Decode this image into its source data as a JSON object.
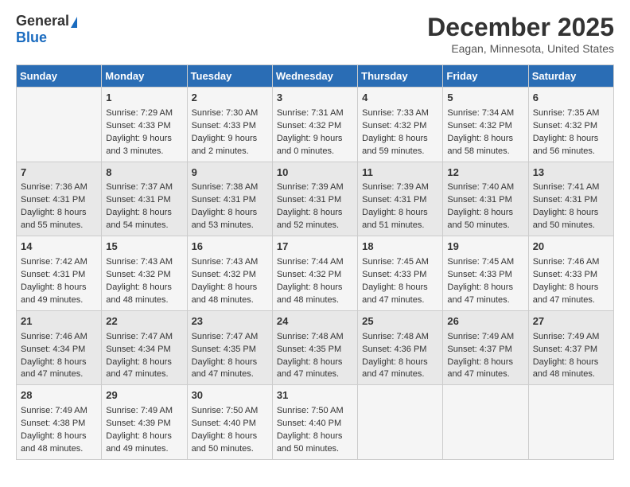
{
  "header": {
    "logo_general": "General",
    "logo_blue": "Blue",
    "month_title": "December 2025",
    "location": "Eagan, Minnesota, United States"
  },
  "days_of_week": [
    "Sunday",
    "Monday",
    "Tuesday",
    "Wednesday",
    "Thursday",
    "Friday",
    "Saturday"
  ],
  "weeks": [
    [
      {
        "day": "",
        "sunrise": "",
        "sunset": "",
        "daylight": ""
      },
      {
        "day": "1",
        "sunrise": "Sunrise: 7:29 AM",
        "sunset": "Sunset: 4:33 PM",
        "daylight": "Daylight: 9 hours and 3 minutes."
      },
      {
        "day": "2",
        "sunrise": "Sunrise: 7:30 AM",
        "sunset": "Sunset: 4:33 PM",
        "daylight": "Daylight: 9 hours and 2 minutes."
      },
      {
        "day": "3",
        "sunrise": "Sunrise: 7:31 AM",
        "sunset": "Sunset: 4:32 PM",
        "daylight": "Daylight: 9 hours and 0 minutes."
      },
      {
        "day": "4",
        "sunrise": "Sunrise: 7:33 AM",
        "sunset": "Sunset: 4:32 PM",
        "daylight": "Daylight: 8 hours and 59 minutes."
      },
      {
        "day": "5",
        "sunrise": "Sunrise: 7:34 AM",
        "sunset": "Sunset: 4:32 PM",
        "daylight": "Daylight: 8 hours and 58 minutes."
      },
      {
        "day": "6",
        "sunrise": "Sunrise: 7:35 AM",
        "sunset": "Sunset: 4:32 PM",
        "daylight": "Daylight: 8 hours and 56 minutes."
      }
    ],
    [
      {
        "day": "7",
        "sunrise": "Sunrise: 7:36 AM",
        "sunset": "Sunset: 4:31 PM",
        "daylight": "Daylight: 8 hours and 55 minutes."
      },
      {
        "day": "8",
        "sunrise": "Sunrise: 7:37 AM",
        "sunset": "Sunset: 4:31 PM",
        "daylight": "Daylight: 8 hours and 54 minutes."
      },
      {
        "day": "9",
        "sunrise": "Sunrise: 7:38 AM",
        "sunset": "Sunset: 4:31 PM",
        "daylight": "Daylight: 8 hours and 53 minutes."
      },
      {
        "day": "10",
        "sunrise": "Sunrise: 7:39 AM",
        "sunset": "Sunset: 4:31 PM",
        "daylight": "Daylight: 8 hours and 52 minutes."
      },
      {
        "day": "11",
        "sunrise": "Sunrise: 7:39 AM",
        "sunset": "Sunset: 4:31 PM",
        "daylight": "Daylight: 8 hours and 51 minutes."
      },
      {
        "day": "12",
        "sunrise": "Sunrise: 7:40 AM",
        "sunset": "Sunset: 4:31 PM",
        "daylight": "Daylight: 8 hours and 50 minutes."
      },
      {
        "day": "13",
        "sunrise": "Sunrise: 7:41 AM",
        "sunset": "Sunset: 4:31 PM",
        "daylight": "Daylight: 8 hours and 50 minutes."
      }
    ],
    [
      {
        "day": "14",
        "sunrise": "Sunrise: 7:42 AM",
        "sunset": "Sunset: 4:31 PM",
        "daylight": "Daylight: 8 hours and 49 minutes."
      },
      {
        "day": "15",
        "sunrise": "Sunrise: 7:43 AM",
        "sunset": "Sunset: 4:32 PM",
        "daylight": "Daylight: 8 hours and 48 minutes."
      },
      {
        "day": "16",
        "sunrise": "Sunrise: 7:43 AM",
        "sunset": "Sunset: 4:32 PM",
        "daylight": "Daylight: 8 hours and 48 minutes."
      },
      {
        "day": "17",
        "sunrise": "Sunrise: 7:44 AM",
        "sunset": "Sunset: 4:32 PM",
        "daylight": "Daylight: 8 hours and 48 minutes."
      },
      {
        "day": "18",
        "sunrise": "Sunrise: 7:45 AM",
        "sunset": "Sunset: 4:33 PM",
        "daylight": "Daylight: 8 hours and 47 minutes."
      },
      {
        "day": "19",
        "sunrise": "Sunrise: 7:45 AM",
        "sunset": "Sunset: 4:33 PM",
        "daylight": "Daylight: 8 hours and 47 minutes."
      },
      {
        "day": "20",
        "sunrise": "Sunrise: 7:46 AM",
        "sunset": "Sunset: 4:33 PM",
        "daylight": "Daylight: 8 hours and 47 minutes."
      }
    ],
    [
      {
        "day": "21",
        "sunrise": "Sunrise: 7:46 AM",
        "sunset": "Sunset: 4:34 PM",
        "daylight": "Daylight: 8 hours and 47 minutes."
      },
      {
        "day": "22",
        "sunrise": "Sunrise: 7:47 AM",
        "sunset": "Sunset: 4:34 PM",
        "daylight": "Daylight: 8 hours and 47 minutes."
      },
      {
        "day": "23",
        "sunrise": "Sunrise: 7:47 AM",
        "sunset": "Sunset: 4:35 PM",
        "daylight": "Daylight: 8 hours and 47 minutes."
      },
      {
        "day": "24",
        "sunrise": "Sunrise: 7:48 AM",
        "sunset": "Sunset: 4:35 PM",
        "daylight": "Daylight: 8 hours and 47 minutes."
      },
      {
        "day": "25",
        "sunrise": "Sunrise: 7:48 AM",
        "sunset": "Sunset: 4:36 PM",
        "daylight": "Daylight: 8 hours and 47 minutes."
      },
      {
        "day": "26",
        "sunrise": "Sunrise: 7:49 AM",
        "sunset": "Sunset: 4:37 PM",
        "daylight": "Daylight: 8 hours and 47 minutes."
      },
      {
        "day": "27",
        "sunrise": "Sunrise: 7:49 AM",
        "sunset": "Sunset: 4:37 PM",
        "daylight": "Daylight: 8 hours and 48 minutes."
      }
    ],
    [
      {
        "day": "28",
        "sunrise": "Sunrise: 7:49 AM",
        "sunset": "Sunset: 4:38 PM",
        "daylight": "Daylight: 8 hours and 48 minutes."
      },
      {
        "day": "29",
        "sunrise": "Sunrise: 7:49 AM",
        "sunset": "Sunset: 4:39 PM",
        "daylight": "Daylight: 8 hours and 49 minutes."
      },
      {
        "day": "30",
        "sunrise": "Sunrise: 7:50 AM",
        "sunset": "Sunset: 4:40 PM",
        "daylight": "Daylight: 8 hours and 50 minutes."
      },
      {
        "day": "31",
        "sunrise": "Sunrise: 7:50 AM",
        "sunset": "Sunset: 4:40 PM",
        "daylight": "Daylight: 8 hours and 50 minutes."
      },
      {
        "day": "",
        "sunrise": "",
        "sunset": "",
        "daylight": ""
      },
      {
        "day": "",
        "sunrise": "",
        "sunset": "",
        "daylight": ""
      },
      {
        "day": "",
        "sunrise": "",
        "sunset": "",
        "daylight": ""
      }
    ]
  ]
}
